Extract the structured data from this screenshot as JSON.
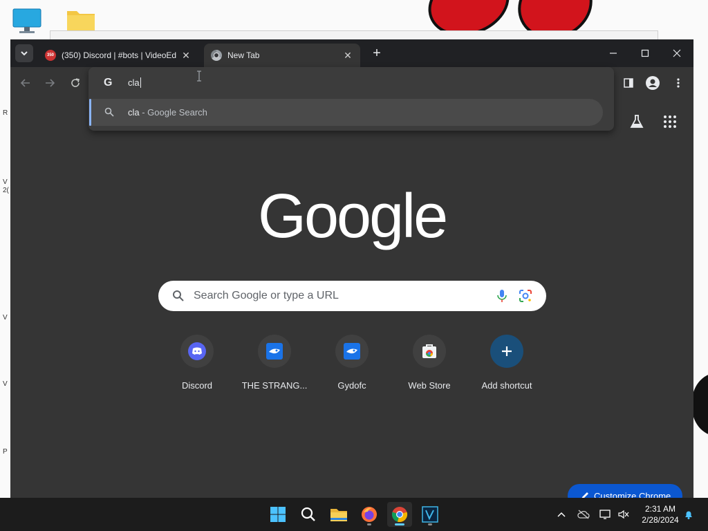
{
  "browser": {
    "tabs": [
      {
        "title": "(350) Discord | #bots | VideoEd",
        "badge": "350",
        "active": false
      },
      {
        "title": "New Tab",
        "active": true
      }
    ],
    "new_tab_symbol": "+",
    "omnibox": {
      "typed_text": "cla",
      "suggestion": {
        "query": "cla",
        "suffix": " - Google Search"
      }
    }
  },
  "ntp": {
    "logo_text": "Google",
    "search_placeholder": "Search Google or type a URL",
    "shortcuts": [
      {
        "label": "Discord",
        "icon": "discord-icon"
      },
      {
        "label": "THE STRANG...",
        "icon": "blue-bird-icon"
      },
      {
        "label": "Gydofc",
        "icon": "blue-bird-icon"
      },
      {
        "label": "Web Store",
        "icon": "web-store-icon"
      },
      {
        "label": "Add shortcut",
        "icon": "plus-icon"
      }
    ],
    "customize_label": "Customize Chrome"
  },
  "taskbar": {
    "time": "2:31 AM",
    "date": "2/28/2024"
  },
  "desktop": {
    "edge_labels": [
      "R",
      "V",
      "2(",
      "V",
      "V",
      "P"
    ]
  },
  "colors": {
    "chrome_bg": "#353535",
    "tabstrip_bg": "#202124",
    "accent_blue": "#8ab4f8",
    "customize_blue": "#0b57d0",
    "taskbar_bg": "#1c1c1c"
  }
}
